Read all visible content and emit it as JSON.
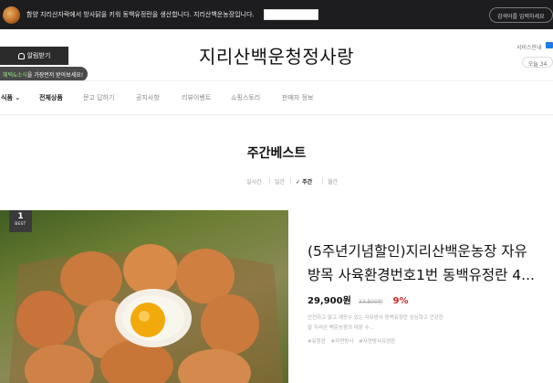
{
  "topbar": {
    "notice": "함양 지리산자락에서 방사닭을 키워 동백유정란을 생산합니다. 지리산백운농장입니다.",
    "search_placeholder": "검색어를 입력하세요"
  },
  "header": {
    "alert_button": "알림받기",
    "tooltip_highlight": "혜택&소식",
    "tooltip_rest": "을 가장먼저 받아보세요!",
    "site_title": "지리산백운청정사랑",
    "service_guide": "서비스안내",
    "today_label": "오늘 34"
  },
  "nav": {
    "items": [
      {
        "label": "식품 ⌄",
        "bold": true
      },
      {
        "label": "전체상품",
        "bold": true
      },
      {
        "label": "문고 답하기",
        "bold": false
      },
      {
        "label": "공지사항",
        "bold": false
      },
      {
        "label": "리뷰이벤트",
        "bold": false
      },
      {
        "label": "쇼핑스토리",
        "bold": false
      },
      {
        "label": "판매자 정보",
        "bold": false
      }
    ]
  },
  "section": {
    "title": "주간베스트",
    "tabs": [
      "실시간",
      "일간",
      "✓ 주간",
      "월간"
    ],
    "active_tab": "주간"
  },
  "product": {
    "rank": "1",
    "rank_label": "BEST",
    "name": "(5주년기념할인)지리산백운농장 자유방목 사육환경번호1번 동백유정란 4...",
    "price": "29,900원",
    "original_price": "33,800원",
    "discount": "9%",
    "description": "안전하고 맑고 깨끗수 있는 자유방사 동백유정란 싱싱하고 건강한 말 지리산 백운농장의 대장 수...",
    "tags": [
      "#유정란",
      "#자연방사",
      "#자연방사유정란"
    ]
  },
  "colors": {
    "topbar_bg": "#1d1d1f",
    "discount": "#c62828",
    "accent_green": "#8fe07a"
  }
}
